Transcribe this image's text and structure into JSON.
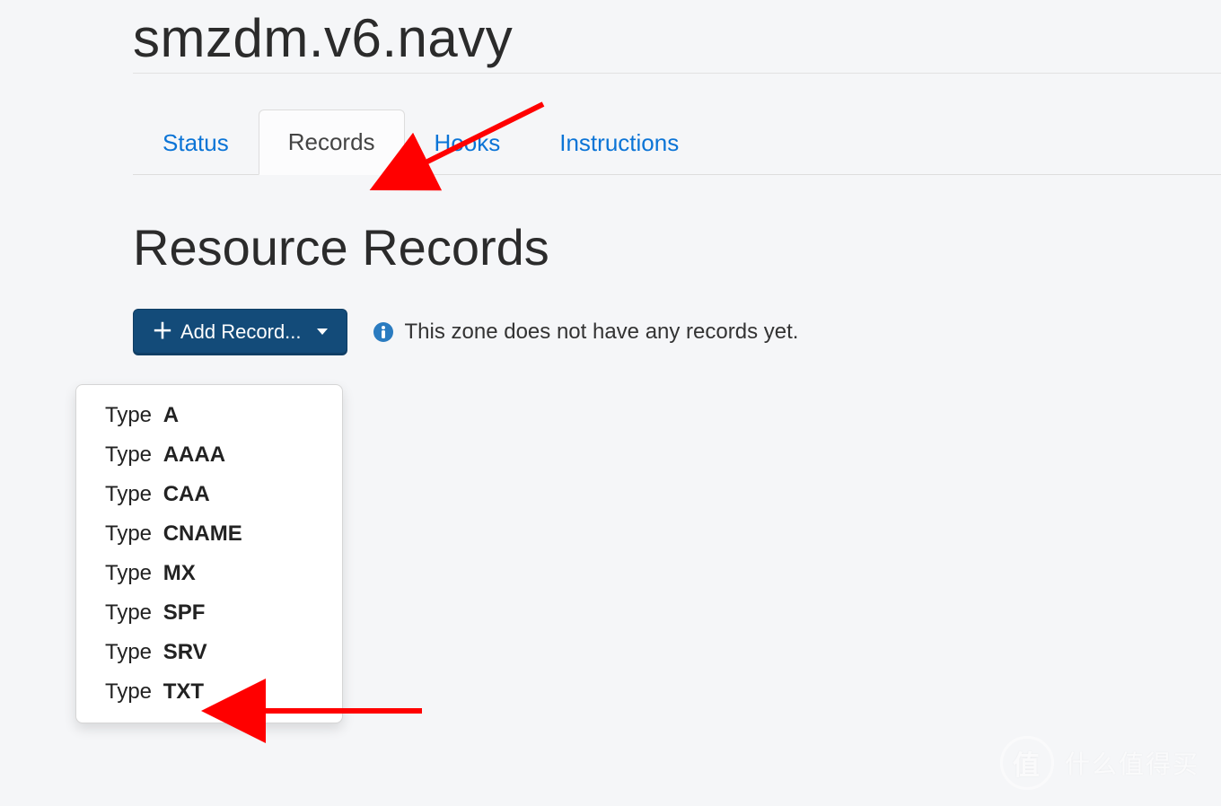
{
  "header": {
    "domain_title": "smzdm.v6.navy"
  },
  "tabs": {
    "items": [
      {
        "label": "Status",
        "active": false
      },
      {
        "label": "Records",
        "active": true
      },
      {
        "label": "Hooks",
        "active": false
      },
      {
        "label": "Instructions",
        "active": false
      }
    ]
  },
  "section": {
    "title": "Resource Records"
  },
  "add_button": {
    "label": "Add Record..."
  },
  "empty_state": {
    "text": "This zone does not have any records yet."
  },
  "record_type_menu": {
    "prefix": "Type",
    "items": [
      {
        "value": "A"
      },
      {
        "value": "AAAA"
      },
      {
        "value": "CAA"
      },
      {
        "value": "CNAME"
      },
      {
        "value": "MX"
      },
      {
        "value": "SPF"
      },
      {
        "value": "SRV"
      },
      {
        "value": "TXT"
      }
    ]
  },
  "watermark": {
    "badge": "值",
    "text": "什么值得买"
  },
  "annotation": {
    "color": "#ff0000"
  }
}
